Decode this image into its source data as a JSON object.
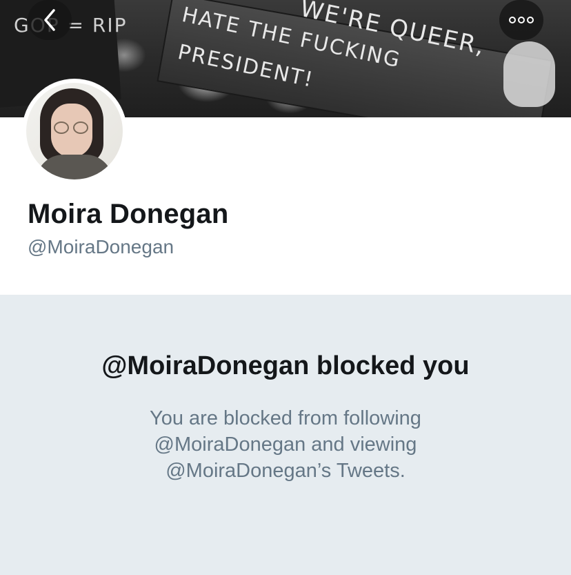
{
  "header": {
    "banner_text": [
      "WE'RE QUEER,",
      "HATE THE FUCKING",
      "PRESIDENT!",
      "GOP = RIP"
    ],
    "back_icon": "chevron-left-icon",
    "more_icon": "more-dots-icon"
  },
  "profile": {
    "name": "Moira Donegan",
    "handle": "@MoiraDonegan"
  },
  "blocked": {
    "title": "@MoiraDonegan blocked you",
    "lines": [
      "You are blocked from following",
      "@MoiraDonegan and viewing",
      "@MoiraDonegan’s Tweets."
    ]
  },
  "colors": {
    "panel_bg": "#e6ecf0",
    "text_primary": "#14171a",
    "text_secondary": "#657786"
  }
}
